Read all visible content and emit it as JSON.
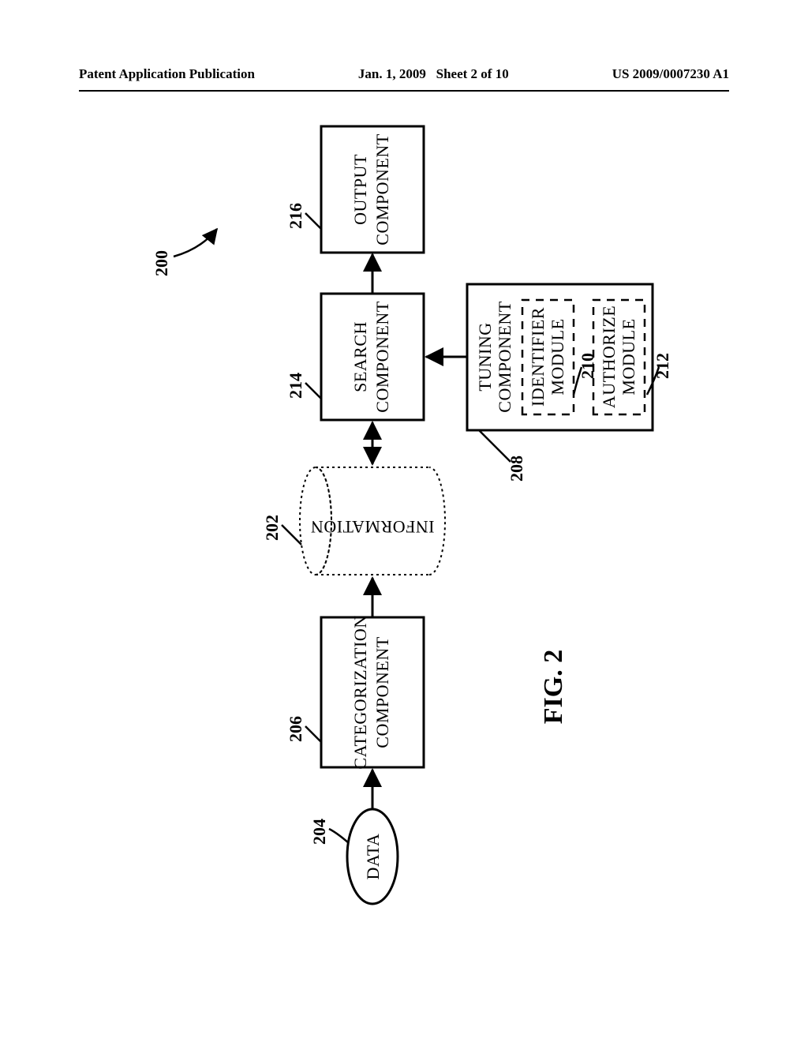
{
  "header": {
    "left": "Patent Application Publication",
    "center_date": "Jan. 1, 2009",
    "center_sheet": "Sheet 2 of 10",
    "right": "US 2009/0007230 A1"
  },
  "figure_label": "FIG. 2",
  "refs": {
    "overall": "200",
    "cylinder": "202",
    "data": "204",
    "categorization": "206",
    "tuning": "208",
    "identifier": "210",
    "authorize": "212",
    "search": "214",
    "output": "216"
  },
  "blocks": {
    "data": "DATA",
    "categorization_l1": "CATEGORIZATION",
    "categorization_l2": "COMPONENT",
    "information": "INFORMATION",
    "search_l1": "SEARCH",
    "search_l2": "COMPONENT",
    "output_l1": "OUTPUT",
    "output_l2": "COMPONENT",
    "tuning_l1": "TUNING",
    "tuning_l2": "COMPONENT",
    "identifier_l1": "IDENTIFIER",
    "identifier_l2": "MODULE",
    "authorize_l1": "AUTHORIZE",
    "authorize_l2": "MODULE"
  }
}
